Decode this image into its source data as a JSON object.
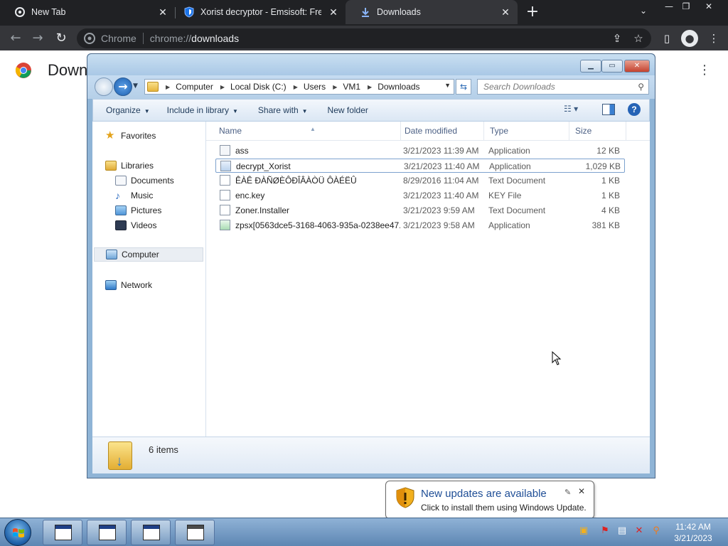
{
  "browser": {
    "tabs": [
      {
        "title": "New Tab",
        "active": false
      },
      {
        "title": "Xorist decryptor - Emsisoft: Free",
        "active": false
      },
      {
        "title": "Downloads",
        "active": true
      }
    ],
    "omnibox": {
      "site": "Chrome",
      "url_scheme": "chrome://",
      "url_path": "downloads"
    },
    "page_title": "Down"
  },
  "explorer": {
    "breadcrumbs": [
      "Computer",
      "Local Disk (C:)",
      "Users",
      "VM1",
      "Downloads"
    ],
    "search_placeholder": "Search Downloads",
    "commands": [
      "Organize",
      "Include in library",
      "Share with",
      "New folder"
    ],
    "nav": {
      "favorites": "Favorites",
      "libraries": "Libraries",
      "library_items": [
        "Documents",
        "Music",
        "Pictures",
        "Videos"
      ],
      "computer": "Computer",
      "network": "Network"
    },
    "columns": {
      "name": "Name",
      "date": "Date modified",
      "type": "Type",
      "size": "Size"
    },
    "files": [
      {
        "name": "ass",
        "date": "3/21/2023 11:39 AM",
        "type": "Application",
        "size": "12 KB"
      },
      {
        "name": "decrypt_Xorist",
        "date": "3/21/2023 11:40 AM",
        "type": "Application",
        "size": "1,029 KB"
      },
      {
        "name": "ÊÀÊ ÐÀÑØÈÔÐÎÂÀÒÜ ÔÀÉËÛ",
        "date": "8/29/2016 11:04 AM",
        "type": "Text Document",
        "size": "1 KB"
      },
      {
        "name": "enc.key",
        "date": "3/21/2023 11:40 AM",
        "type": "KEY File",
        "size": "1 KB"
      },
      {
        "name": "Zoner.Installer",
        "date": "3/21/2023 9:59 AM",
        "type": "Text Document",
        "size": "4 KB"
      },
      {
        "name": "zpsx[0563dce5-3168-4063-935a-0238ee47...",
        "date": "3/21/2023 9:58 AM",
        "type": "Application",
        "size": "381 KB"
      }
    ],
    "item_count": "6 items"
  },
  "notification": {
    "title": "New updates are available",
    "text": "Click to install them using Windows Update."
  },
  "taskbar": {
    "time": "11:42 AM",
    "date": "3/21/2023"
  },
  "colors": {
    "chrome_dark": "#202124",
    "chrome_toolbar": "#35363a",
    "win7_frame": "#a9c8e6",
    "link_blue": "#1f4e96"
  }
}
